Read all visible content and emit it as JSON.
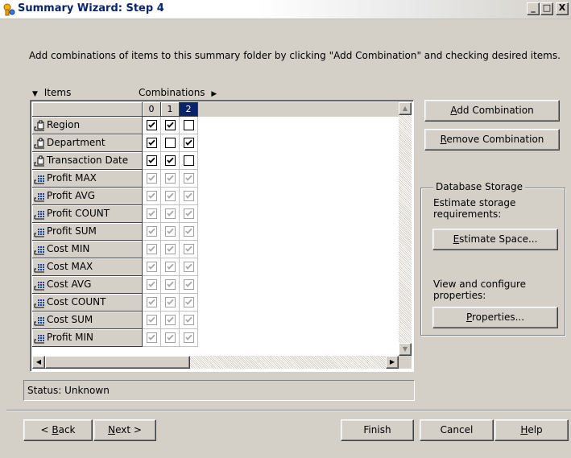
{
  "window": {
    "title": "Summary Wizard: Step 4",
    "minimize": "_",
    "maximize": "□",
    "close": "X"
  },
  "instructions": "Add combinations of items to this summary folder by clicking \"Add Combination\" and checking desired items.",
  "grid": {
    "items_header": "Items",
    "combinations_header": "Combinations",
    "columns": [
      "0",
      "1",
      "2"
    ],
    "selected_column": 2,
    "rows": [
      {
        "label": "Region",
        "icon": "dimension-icon",
        "checks": [
          true,
          true,
          false
        ],
        "enabled": true
      },
      {
        "label": "Department",
        "icon": "dimension-icon",
        "checks": [
          true,
          false,
          true
        ],
        "enabled": true
      },
      {
        "label": "Transaction Date",
        "icon": "dimension-icon",
        "checks": [
          true,
          true,
          false
        ],
        "enabled": true
      },
      {
        "label": "Profit MAX",
        "icon": "measure-icon",
        "checks": [
          true,
          true,
          true
        ],
        "enabled": false
      },
      {
        "label": "Profit AVG",
        "icon": "measure-icon",
        "checks": [
          true,
          true,
          true
        ],
        "enabled": false
      },
      {
        "label": "Profit COUNT",
        "icon": "measure-icon",
        "checks": [
          true,
          true,
          true
        ],
        "enabled": false
      },
      {
        "label": "Profit SUM",
        "icon": "measure-icon",
        "checks": [
          true,
          true,
          true
        ],
        "enabled": false
      },
      {
        "label": "Cost MIN",
        "icon": "measure-icon",
        "checks": [
          true,
          true,
          true
        ],
        "enabled": false
      },
      {
        "label": "Cost MAX",
        "icon": "measure-icon",
        "checks": [
          true,
          true,
          true
        ],
        "enabled": false
      },
      {
        "label": "Cost AVG",
        "icon": "measure-icon",
        "checks": [
          true,
          true,
          true
        ],
        "enabled": false
      },
      {
        "label": "Cost COUNT",
        "icon": "measure-icon",
        "checks": [
          true,
          true,
          true
        ],
        "enabled": false
      },
      {
        "label": "Cost SUM",
        "icon": "measure-icon",
        "checks": [
          true,
          true,
          true
        ],
        "enabled": false
      },
      {
        "label": "Profit MIN",
        "icon": "measure-icon",
        "checks": [
          true,
          true,
          true
        ],
        "enabled": false
      }
    ]
  },
  "buttons": {
    "add_combination": {
      "accel": "A",
      "rest": "dd Combination"
    },
    "remove_combination": {
      "accel": "R",
      "rest": "emove Combination"
    },
    "estimate_space": {
      "accel": "E",
      "rest": "stimate Space..."
    },
    "properties": {
      "accel": "P",
      "rest": "roperties..."
    },
    "back": {
      "pre": "< ",
      "accel": "B",
      "rest": "ack"
    },
    "next": {
      "accel": "N",
      "rest": "ext >"
    },
    "finish": "Finish",
    "cancel": "Cancel",
    "help": {
      "accel": "H",
      "rest": "elp"
    }
  },
  "storage": {
    "legend": "Database Storage",
    "estimate_text": "Estimate storage requirements:",
    "configure_text": "View and configure properties:"
  },
  "status": "Status: Unknown"
}
